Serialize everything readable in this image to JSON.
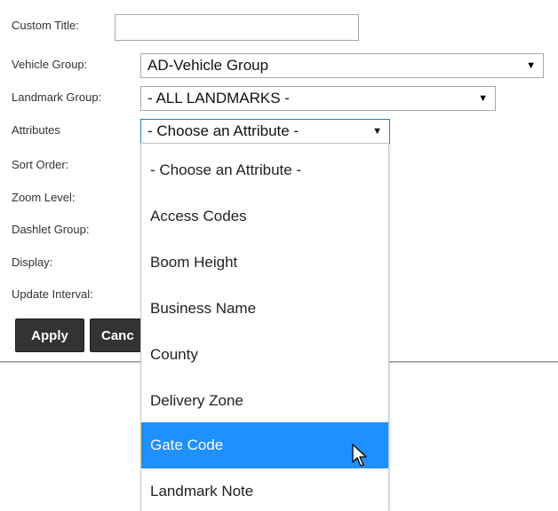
{
  "form": {
    "custom_title": {
      "label": "Custom Title:",
      "value": ""
    },
    "vehicle_group": {
      "label": "Vehicle Group:",
      "value": "AD-Vehicle Group"
    },
    "landmark_group": {
      "label": "Landmark Group:",
      "value": "- ALL LANDMARKS -"
    },
    "attributes": {
      "label": "Attributes",
      "value": "- Choose an Attribute -"
    },
    "sort_order": {
      "label": "Sort Order:"
    },
    "zoom_level": {
      "label": "Zoom Level:"
    },
    "dashlet_group": {
      "label": "Dashlet Group:"
    },
    "display": {
      "label": "Display:"
    },
    "update_interval": {
      "label": "Update Interval:"
    }
  },
  "buttons": {
    "apply": "Apply",
    "cancel": "Canc"
  },
  "dropdown": {
    "options": [
      "- Choose an Attribute -",
      "Access Codes",
      "Boom Height",
      "Business Name",
      "County",
      "Delivery Zone",
      "Gate Code",
      "Landmark Note"
    ],
    "highlighted": "Gate Code"
  },
  "icons": {
    "select_arrow": "▼",
    "cursor": "arrow-cursor-icon"
  },
  "colors": {
    "highlight": "#1e90ff",
    "button_bg": "#333333",
    "focus_border": "#1e7fd8"
  }
}
